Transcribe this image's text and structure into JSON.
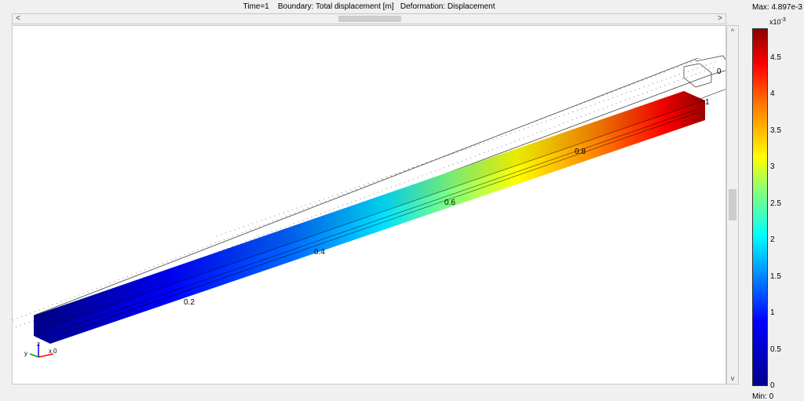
{
  "header": {
    "time": "Time=1",
    "boundary": "Boundary: Total displacement [m]",
    "deformation": "Deformation: Displacement"
  },
  "scroll": {
    "left_arrow": "<",
    "right_arrow": ">",
    "up_arrow": "^",
    "down_arrow": "v"
  },
  "plot": {
    "axis_ticks": [
      "0.2",
      "0.4",
      "0.6",
      "0.8",
      "1",
      "0"
    ],
    "triad": {
      "x": "x",
      "y": "y",
      "z": "z",
      "origin": "0"
    }
  },
  "legend": {
    "max": "Max: 4.897e-3",
    "exponent_base": "x10",
    "exponent_power": "-3",
    "ticks": [
      "4.5",
      "4",
      "3.5",
      "3",
      "2.5",
      "2",
      "1.5",
      "1",
      "0.5",
      "0"
    ],
    "min": "Min: 0"
  }
}
